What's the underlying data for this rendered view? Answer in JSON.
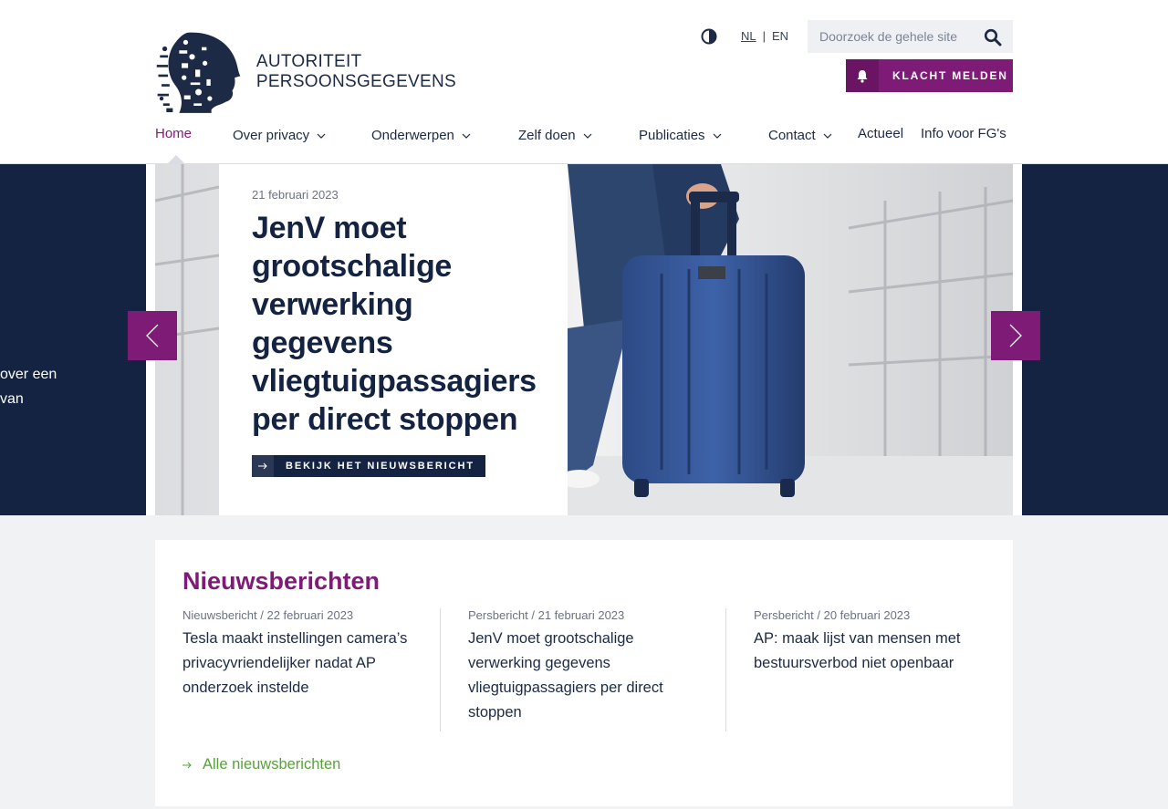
{
  "brand": {
    "name_line1": "AUTORITEIT",
    "name_line2": "PERSOONSGEGEVENS"
  },
  "header": {
    "lang_nl": "NL",
    "lang_separator": "|",
    "lang_en": "EN",
    "search_placeholder": "Doorzoek de gehele site",
    "complaint_label": "KLACHT MELDEN"
  },
  "nav": {
    "items": [
      {
        "label": "Home",
        "active": true
      },
      {
        "label": "Over privacy",
        "dropdown": true
      },
      {
        "label": "Onderwerpen",
        "dropdown": true
      },
      {
        "label": "Zelf doen",
        "dropdown": true
      },
      {
        "label": "Publicaties",
        "dropdown": true
      },
      {
        "label": "Contact",
        "dropdown": true
      },
      {
        "label": "Actueel"
      },
      {
        "label": "Info voor FG's"
      }
    ]
  },
  "hero": {
    "prev_slide_fragment_line1": "over een",
    "prev_slide_fragment_line2": "van",
    "date": "21 februari 2023",
    "title": "JenV moet grootschalige verwerking gegevens vliegtuigpassagiers per direct stoppen",
    "button_label": "BEKIJK HET NIEUWSBERICHT"
  },
  "news": {
    "heading": "Nieuwsberichten",
    "items": [
      {
        "meta": "Nieuwsbericht / 22 februari 2023",
        "title": "Tesla maakt instellingen camera’s privacyvriendelijker nadat AP onderzoek instelde"
      },
      {
        "meta": "Persbericht / 21 februari 2023",
        "title": "JenV moet grootschalige verwerking gegevens vliegtuigpassagiers per direct stoppen"
      },
      {
        "meta": "Persbericht / 20 februari 2023",
        "title": "AP: maak lijst van mensen met bestuursverbod niet openbaar"
      }
    ],
    "all_label": "Alle nieuwsberichten"
  },
  "colors": {
    "brand_purple": "#7e1b76",
    "navy": "#132341",
    "link_green": "#5aa03c"
  }
}
